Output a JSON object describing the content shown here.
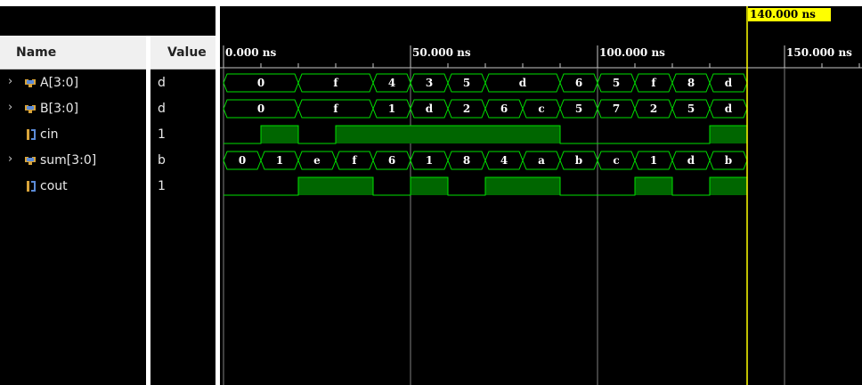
{
  "columns": {
    "name": "Name",
    "value": "Value"
  },
  "cursor": {
    "label": "140.000 ns",
    "time": 140
  },
  "time_axis": {
    "ticks": [
      {
        "time": 0,
        "label": "0.000 ns"
      },
      {
        "time": 50,
        "label": "50.000 ns"
      },
      {
        "time": 100,
        "label": "100.000 ns"
      },
      {
        "time": 150,
        "label": "150.000 ns"
      }
    ]
  },
  "signals": [
    {
      "name": "A[3:0]",
      "value": "d",
      "type": "bus",
      "expandable": true,
      "icon": "bus-icon",
      "segments": [
        [
          "0",
          0,
          20
        ],
        [
          "f",
          20,
          40
        ],
        [
          "4",
          40,
          50
        ],
        [
          "3",
          50,
          60
        ],
        [
          "5",
          60,
          70
        ],
        [
          "d",
          70,
          90
        ],
        [
          "6",
          90,
          100
        ],
        [
          "5",
          100,
          110
        ],
        [
          "f",
          110,
          120
        ],
        [
          "8",
          120,
          130
        ],
        [
          "d",
          130,
          140
        ]
      ]
    },
    {
      "name": "B[3:0]",
      "value": "d",
      "type": "bus",
      "expandable": true,
      "icon": "bus-icon",
      "segments": [
        [
          "0",
          0,
          20
        ],
        [
          "f",
          20,
          40
        ],
        [
          "1",
          40,
          50
        ],
        [
          "d",
          50,
          60
        ],
        [
          "2",
          60,
          70
        ],
        [
          "6",
          70,
          80
        ],
        [
          "c",
          80,
          90
        ],
        [
          "5",
          90,
          100
        ],
        [
          "7",
          100,
          110
        ],
        [
          "2",
          110,
          120
        ],
        [
          "5",
          120,
          130
        ],
        [
          "d",
          130,
          140
        ]
      ]
    },
    {
      "name": "cin",
      "value": "1",
      "type": "bit",
      "expandable": false,
      "icon": "bit-icon",
      "segments": [
        [
          0,
          0,
          10
        ],
        [
          1,
          10,
          20
        ],
        [
          0,
          20,
          30
        ],
        [
          1,
          30,
          90
        ],
        [
          0,
          90,
          130
        ],
        [
          1,
          130,
          140
        ]
      ]
    },
    {
      "name": "sum[3:0]",
      "value": "b",
      "type": "bus",
      "expandable": true,
      "icon": "bus-icon",
      "segments": [
        [
          "0",
          0,
          10
        ],
        [
          "1",
          10,
          20
        ],
        [
          "e",
          20,
          30
        ],
        [
          "f",
          30,
          40
        ],
        [
          "6",
          40,
          50
        ],
        [
          "1",
          50,
          60
        ],
        [
          "8",
          60,
          70
        ],
        [
          "4",
          70,
          80
        ],
        [
          "a",
          80,
          90
        ],
        [
          "b",
          90,
          100
        ],
        [
          "c",
          100,
          110
        ],
        [
          "1",
          110,
          120
        ],
        [
          "d",
          120,
          130
        ],
        [
          "b",
          130,
          140
        ]
      ]
    },
    {
      "name": "cout",
      "value": "1",
      "type": "bit",
      "expandable": false,
      "icon": "bit-icon",
      "segments": [
        [
          0,
          0,
          20
        ],
        [
          1,
          20,
          40
        ],
        [
          0,
          40,
          50
        ],
        [
          1,
          50,
          60
        ],
        [
          0,
          60,
          70
        ],
        [
          1,
          70,
          90
        ],
        [
          0,
          90,
          110
        ],
        [
          1,
          110,
          120
        ],
        [
          0,
          120,
          130
        ],
        [
          1,
          130,
          140
        ]
      ]
    }
  ],
  "colors": {
    "wave": "#00e000",
    "fill": "#006600",
    "cursor": "#ffff00",
    "grid": "#808080",
    "background": "#000000"
  }
}
